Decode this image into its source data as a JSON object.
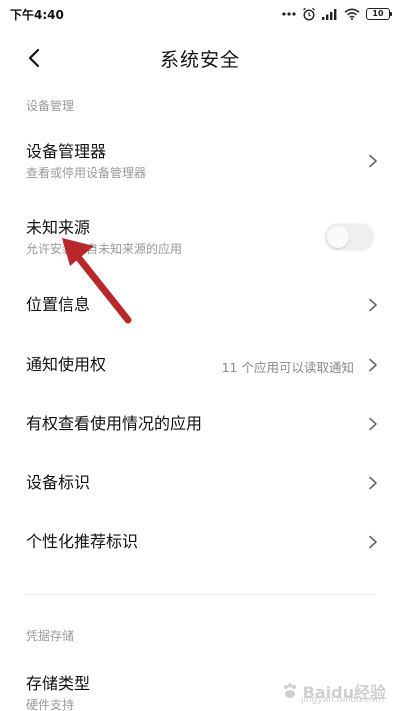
{
  "status_bar": {
    "time": "下午4:40",
    "battery": "10"
  },
  "header": {
    "title": "系统安全"
  },
  "sections": {
    "device_management": "设备管理",
    "credential_storage": "凭据存储"
  },
  "rows": {
    "device_admin": {
      "title": "设备管理器",
      "subtitle": "查看或停用设备管理器"
    },
    "unknown_sources": {
      "title": "未知来源",
      "subtitle": "允许安装来自未知来源的应用",
      "enabled": false
    },
    "location": {
      "title": "位置信息"
    },
    "notification_access": {
      "title": "通知使用权",
      "value": "11 个应用可以读取通知"
    },
    "usage_access": {
      "title": "有权查看使用情况的应用"
    },
    "device_id": {
      "title": "设备标识"
    },
    "personalized_id": {
      "title": "个性化推荐标识"
    },
    "storage_type": {
      "title": "存储类型",
      "subtitle": "硬件支持"
    }
  },
  "watermark": {
    "text": "Baidu经验",
    "sub": "jingyan.baidu.com"
  },
  "colors": {
    "annotation_arrow": "#b8282a",
    "secondary_text": "#9a9a9a",
    "toggle_off": "#efefef"
  }
}
